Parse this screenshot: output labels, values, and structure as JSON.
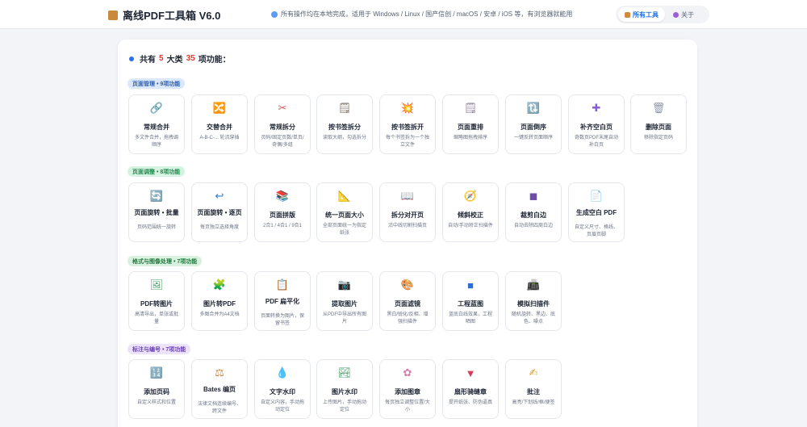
{
  "header": {
    "app_title": "离线PDF工具箱 V6.0",
    "notice": "所有操作均在本地完成，适用于 Windows / Linux / 国产信创 / macOS / 安卓 / iOS 等，有浏览器就能用",
    "nav": [
      {
        "label": "所有工具",
        "active": true
      },
      {
        "label": "关于",
        "active": false
      }
    ]
  },
  "summary": {
    "prefix": "共有",
    "categories": "5",
    "mid": "大类",
    "functions": "35",
    "suffix": "项功能："
  },
  "sections": [
    {
      "badge": "页面管理 • 9项功能",
      "badge_bg": "#dbe8fb",
      "badge_color": "#2a5fb5",
      "tools": [
        {
          "title": "常规合并",
          "desc": "多文件合并，拖拽调顺序",
          "icon": "link-icon"
        },
        {
          "title": "交替合并",
          "desc": "A-B-C-... 轮流穿插",
          "icon": "shuffle-icon"
        },
        {
          "title": "常规拆分",
          "desc": "页码/固定页数/单页/奇偶/多组",
          "icon": "scissors-icon"
        },
        {
          "title": "按书签拆分",
          "desc": "读取大纲，勾选拆分",
          "icon": "bookmark-doc-icon"
        },
        {
          "title": "按书签拆开",
          "desc": "每个书签拆为一个独立文件",
          "icon": "burst-icon"
        },
        {
          "title": "页面重排",
          "desc": "缩略图拖拽排序",
          "icon": "reorder-doc-icon"
        },
        {
          "title": "页面倒序",
          "desc": "一键反转页面顺序",
          "icon": "reverse-icon"
        },
        {
          "title": "补齐空白页",
          "desc": "奇数页PDF末尾自动补白页",
          "icon": "plus-icon"
        },
        {
          "title": "删除页面",
          "desc": "移除指定页码",
          "icon": "trash-icon"
        }
      ]
    },
    {
      "badge": "页面调整 • 8项功能",
      "badge_bg": "#d6f3e2",
      "badge_color": "#1e8a4c",
      "tools": [
        {
          "title": "页面旋转 • 批量",
          "desc": "页码范围统一旋转",
          "icon": "rotate-icon"
        },
        {
          "title": "页面旋转 • 逐页",
          "desc": "每页独立选择角度",
          "icon": "return-icon"
        },
        {
          "title": "页面拼版",
          "desc": "2合1 / 4合1 / 9合1",
          "icon": "books-icon"
        },
        {
          "title": "统一页面大小",
          "desc": "全部页面统一为指定纸张",
          "icon": "ruler-icon"
        },
        {
          "title": "拆分对开页",
          "desc": "沿中线切割扫描页",
          "icon": "open-book-icon"
        },
        {
          "title": "倾斜校正",
          "desc": "自动/手动矫正扫描件",
          "icon": "compass-icon"
        },
        {
          "title": "裁剪白边",
          "desc": "自动去除四周白边",
          "icon": "crop-square-icon"
        },
        {
          "title": "生成空白 PDF",
          "desc": "自定义尺寸、格线、页眉页脚",
          "icon": "blank-doc-icon"
        }
      ]
    },
    {
      "badge": "格式与图像处理 • 7项功能",
      "badge_bg": "#d8f2df",
      "badge_color": "#1f7a3e",
      "tools": [
        {
          "title": "PDF转图片",
          "desc": "高清导出，单张或批量",
          "icon": "picture-icon"
        },
        {
          "title": "图片转PDF",
          "desc": "多图合并为A4文档",
          "icon": "puzzle-icon"
        },
        {
          "title": "PDF 扁平化",
          "desc": "页面转换为图片，保留书签",
          "icon": "clipboard-icon"
        },
        {
          "title": "提取图片",
          "desc": "从PDF中导出所有图片",
          "icon": "camera-icon"
        },
        {
          "title": "页面滤镜",
          "desc": "黑白/锐化/反相、增强扫描件",
          "icon": "palette-icon"
        },
        {
          "title": "工程蓝图",
          "desc": "蓝底白线效果，工程晒图",
          "icon": "blue-square-icon"
        },
        {
          "title": "模拟扫描件",
          "desc": "随机旋转、黑边、底色、噪点",
          "icon": "fax-icon"
        }
      ]
    },
    {
      "badge": "标注与编号 • 7项功能",
      "badge_bg": "#ece3fb",
      "badge_color": "#6a3fb8",
      "tools": [
        {
          "title": "添加页码",
          "desc": "自定义样式和位置",
          "icon": "numbers-icon"
        },
        {
          "title": "Bates 编页",
          "desc": "法律文档连续编号、跨文件",
          "icon": "scales-icon"
        },
        {
          "title": "文字水印",
          "desc": "自定义内容，手动拖动定位",
          "icon": "droplet-icon"
        },
        {
          "title": "图片水印",
          "desc": "上传图片，手动拖动定位",
          "icon": "landscape-icon"
        },
        {
          "title": "添加图章",
          "desc": "每页独立调整位置/大小",
          "icon": "flower-stamp-icon"
        },
        {
          "title": "扇形骑缝章",
          "desc": "提开纸张、防伪逼真",
          "icon": "fan-seal-icon"
        },
        {
          "title": "批注",
          "desc": "高亮/下划线/框/便签",
          "icon": "pen-hand-icon"
        }
      ]
    }
  ],
  "colors": {
    "accent": "#1f6fe0",
    "count_red": "#e03a2f",
    "panel_bg": "#ffffff",
    "page_bg": "#f2f4f8"
  }
}
